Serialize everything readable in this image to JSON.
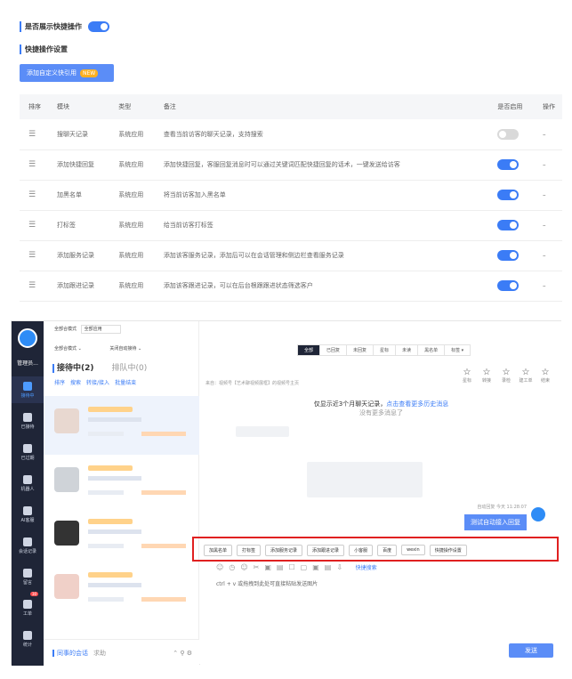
{
  "settings": {
    "show_quick_label": "是否展示快捷操作",
    "show_quick_enabled": true,
    "section_title": "快捷操作设置",
    "add_button_label": "添加自定义快引用",
    "add_button_badge": "NEW",
    "columns": [
      "排序",
      "模块",
      "类型",
      "备注",
      "是否启用",
      "操作"
    ],
    "rows": [
      {
        "module": "搜聊天记录",
        "type": "系统应用",
        "note": "查看当前访客的聊天记录，支持搜索",
        "enabled": false,
        "op": "–"
      },
      {
        "module": "添加快捷回复",
        "type": "系统应用",
        "note": "添加快捷回复，客服回复消息时可以通过关键词匹配快捷回复的话术，一键发送给访客",
        "enabled": true,
        "op": "–"
      },
      {
        "module": "加黑名单",
        "type": "系统应用",
        "note": "将当前访客加入黑名单",
        "enabled": true,
        "op": "–"
      },
      {
        "module": "打标签",
        "type": "系统应用",
        "note": "给当前访客打标签",
        "enabled": true,
        "op": "–"
      },
      {
        "module": "添加服务记录",
        "type": "系统应用",
        "note": "添加该客服务记录，添加后可以在会话管理和侧边栏查看服务记录",
        "enabled": true,
        "op": "–"
      },
      {
        "module": "添加跟进记录",
        "type": "系统应用",
        "note": "添加该客跟进记录，可以在后台根跟跟进状态筛选客户",
        "enabled": true,
        "op": "–"
      }
    ]
  },
  "app": {
    "user_name": "管理员...",
    "nav": [
      {
        "label": "接待中",
        "active": true
      },
      {
        "label": "已接待"
      },
      {
        "label": "已过期"
      },
      {
        "label": "机器人"
      },
      {
        "label": "AI客服"
      },
      {
        "label": "会话记录"
      },
      {
        "label": "留言"
      },
      {
        "label": "工单",
        "badge": "30"
      },
      {
        "label": "统计"
      }
    ],
    "conv_mode_label": "全部合模式",
    "conv_mode_value": "全部应用",
    "sort_label": "全部合模式",
    "auto_label": "关闭自动接待",
    "tab_active": "接待中(2)",
    "tab_queue": "排队中(0)",
    "actions": [
      "排序",
      "搜索",
      "转接/接入",
      "批量结束"
    ],
    "bottom_tab_active": "同事的会话",
    "bottom_tab_other": "求助"
  },
  "chat": {
    "filter_tabs": [
      "全部",
      "已回复",
      "未回复",
      "星标",
      "未读",
      "黑名单",
      "标签 ▾"
    ],
    "source": "来自：视频号【艺术聊视频展框】的视频号主页",
    "tools": [
      "星标",
      "转接",
      "录检",
      "建工单",
      "结束"
    ],
    "history_text": "仅显示近3个月聊天记录，",
    "history_link": "点击查看更多历史消息",
    "no_more": "没有更多消息了",
    "auto_label": "自动回复  今天 11:28:07",
    "auto_reply": "测试自动接入回复",
    "quick_buttons": [
      "加黑名单",
      "打标签",
      "添加服务记录",
      "添加跟进记录",
      "小客服",
      "百度",
      "wexin",
      "快捷操作设置"
    ],
    "quick_search": "快捷搜索",
    "paste_hint": "ctrl + v 或拖拽到此处可直接粘贴发送图片",
    "send_label": "发送"
  }
}
